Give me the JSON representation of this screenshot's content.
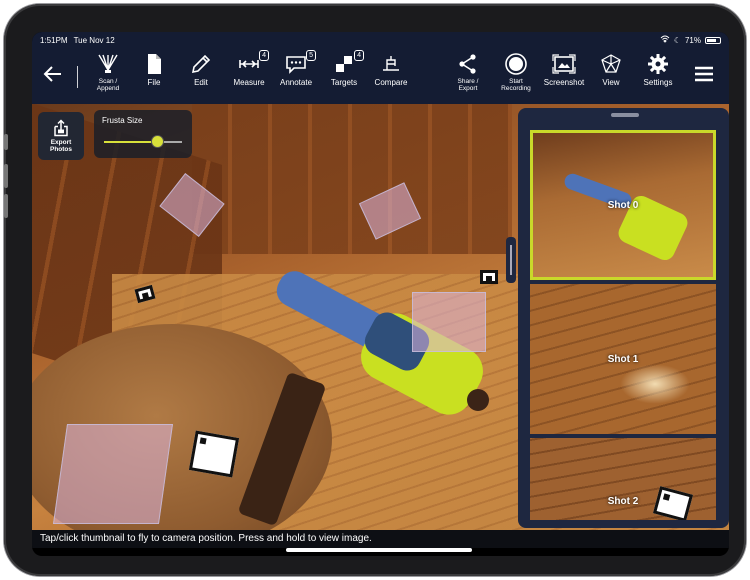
{
  "status": {
    "time": "1:51PM",
    "date": "Tue Nov 12",
    "battery": "71%"
  },
  "toolbar": {
    "scan": "Scan /\nAppend",
    "file": "File",
    "edit": "Edit",
    "measure": "Measure",
    "measure_badge": "4",
    "annotate": "Annotate",
    "annotate_badge": "5",
    "targets": "Targets",
    "targets_badge": "4",
    "compare": "Compare",
    "share": "Share /\nExport",
    "record": "Start\nRecording",
    "screenshot": "Screenshot",
    "view": "View",
    "settings": "Settings"
  },
  "scene": {
    "export_label": "Export\nPhotos",
    "frusta_label": "Frusta Size",
    "frusta_value": 0.68
  },
  "shots": [
    {
      "name": "Shot 0",
      "selected": true
    },
    {
      "name": "Shot 1",
      "selected": false
    },
    {
      "name": "Shot 2",
      "selected": false
    }
  ],
  "hint": "Tap/click thumbnail to fly to camera position. Press and hold to view image.",
  "colors": {
    "toolbar": "#141c33",
    "accent": "#c9d92a",
    "panel": "#1e2740"
  }
}
